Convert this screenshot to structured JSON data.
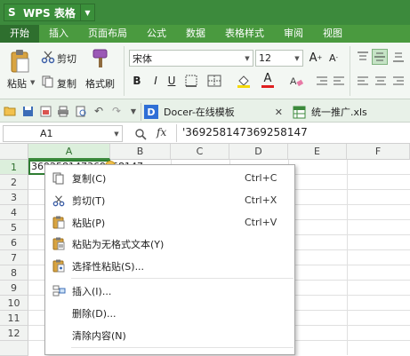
{
  "app": {
    "title": "WPS 表格",
    "logo_letter": "S"
  },
  "ribbon_tabs": [
    "开始",
    "插入",
    "页面布局",
    "公式",
    "数据",
    "表格样式",
    "审阅",
    "视图"
  ],
  "ribbon": {
    "paste_label": "粘贴",
    "cut_label": "剪切",
    "copy_label": "复制",
    "format_painter_label": "格式刷",
    "font_name": "宋体",
    "font_size": "12",
    "bold": "B",
    "italic": "I",
    "underline": "U",
    "font_color_glyph": "A"
  },
  "doc_tabs": [
    {
      "label": "Docer-在线模板",
      "has_close": true
    },
    {
      "label": "统一推广.xls"
    }
  ],
  "formula_bar": {
    "name_box": "A1",
    "fx": "fx",
    "content": "'369258147369258147"
  },
  "columns": [
    "A",
    "B",
    "C",
    "D",
    "E",
    "F"
  ],
  "rows": [
    "1",
    "2",
    "3",
    "4",
    "5",
    "6",
    "7",
    "8",
    "9",
    "10",
    "11",
    "12"
  ],
  "cell_a1_visible": "369258147369258147",
  "context_menu": {
    "items": [
      {
        "label": "复制(C)",
        "shortcut": "Ctrl+C",
        "icon": "copy-icon"
      },
      {
        "label": "剪切(T)",
        "shortcut": "Ctrl+X",
        "icon": "scissors-icon"
      },
      {
        "label": "粘贴(P)",
        "shortcut": "Ctrl+V",
        "icon": "paste-icon"
      },
      {
        "label": "粘贴为无格式文本(Y)",
        "shortcut": "",
        "icon": "paste-text-icon"
      },
      {
        "label": "选择性粘贴(S)...",
        "shortcut": "",
        "icon": "paste-special-icon"
      },
      {
        "label": "插入(I)...",
        "shortcut": "",
        "icon": "insert-icon"
      },
      {
        "label": "删除(D)...",
        "shortcut": "",
        "icon": ""
      },
      {
        "label": "清除内容(N)",
        "shortcut": "",
        "icon": ""
      }
    ]
  },
  "colors": {
    "accent_green": "#3c8a3c",
    "tab_bar": "#4a9a3f",
    "selected_cell_border": "#2e7d32"
  }
}
